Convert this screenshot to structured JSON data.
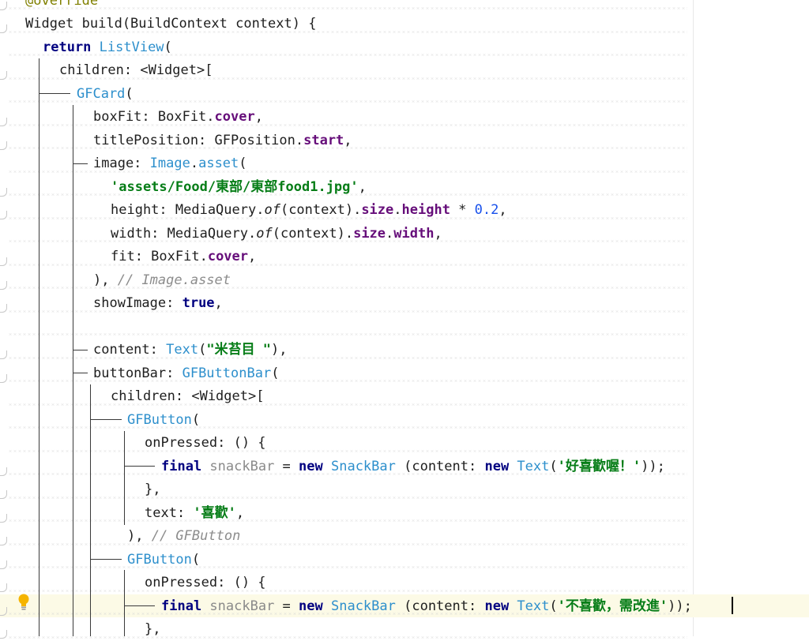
{
  "editor": {
    "lines": [
      {
        "id": "l0",
        "tokens": [
          [
            "anno",
            "@override"
          ]
        ]
      },
      {
        "id": "l1",
        "tokens": [
          [
            "",
            "Widget build(BuildContext context) {"
          ]
        ]
      },
      {
        "id": "l2",
        "tokens": [
          [
            "kw",
            "return "
          ],
          [
            "cls",
            "ListView"
          ],
          [
            "",
            "("
          ]
        ]
      },
      {
        "id": "l3",
        "tokens": [
          [
            "",
            "children: <Widget>["
          ]
        ]
      },
      {
        "id": "l4",
        "tokens": [
          [
            "cls",
            "GFCard"
          ],
          [
            "",
            "("
          ]
        ]
      },
      {
        "id": "l5",
        "tokens": [
          [
            "",
            "boxFit: BoxFit."
          ],
          [
            "fld",
            "cover"
          ],
          [
            "",
            ","
          ]
        ]
      },
      {
        "id": "l6",
        "tokens": [
          [
            "",
            "titlePosition: GFPosition."
          ],
          [
            "fld",
            "start"
          ],
          [
            "",
            ","
          ]
        ]
      },
      {
        "id": "l7",
        "tokens": [
          [
            "",
            "image: "
          ],
          [
            "cls",
            "Image"
          ],
          [
            "",
            "."
          ],
          [
            "cls",
            "asset"
          ],
          [
            "",
            "("
          ]
        ]
      },
      {
        "id": "l8",
        "tokens": [
          [
            "str",
            "'assets/Food/東部/東部food1.jpg'"
          ],
          [
            "",
            ","
          ]
        ]
      },
      {
        "id": "l9",
        "tokens": [
          [
            "",
            "height: MediaQuery."
          ],
          [
            "ital",
            "of"
          ],
          [
            "",
            "(context)."
          ],
          [
            "fld",
            "size"
          ],
          [
            "",
            "."
          ],
          [
            "fld",
            "height"
          ],
          [
            "",
            " * "
          ],
          [
            "num",
            "0.2"
          ],
          [
            "",
            ","
          ]
        ]
      },
      {
        "id": "l10",
        "tokens": [
          [
            "",
            "width: MediaQuery."
          ],
          [
            "ital",
            "of"
          ],
          [
            "",
            "(context)."
          ],
          [
            "fld",
            "size"
          ],
          [
            "",
            "."
          ],
          [
            "fld",
            "width"
          ],
          [
            "",
            ","
          ]
        ]
      },
      {
        "id": "l11",
        "tokens": [
          [
            "",
            "fit: BoxFit."
          ],
          [
            "fld",
            "cover"
          ],
          [
            "",
            ","
          ]
        ]
      },
      {
        "id": "l12",
        "tokens": [
          [
            "",
            "), "
          ],
          [
            "cmt",
            "// Image.asset"
          ]
        ]
      },
      {
        "id": "l13",
        "tokens": [
          [
            "",
            "showImage: "
          ],
          [
            "kw",
            "true"
          ],
          [
            "",
            ","
          ]
        ]
      },
      {
        "id": "l14",
        "tokens": []
      },
      {
        "id": "l15",
        "tokens": [
          [
            "",
            "content: "
          ],
          [
            "cls",
            "Text"
          ],
          [
            "",
            "("
          ],
          [
            "str",
            "\"米苔目 \""
          ],
          [
            "",
            "),"
          ]
        ]
      },
      {
        "id": "l16",
        "tokens": [
          [
            "",
            "buttonBar: "
          ],
          [
            "cls",
            "GFButtonBar"
          ],
          [
            "",
            "("
          ]
        ]
      },
      {
        "id": "l17",
        "tokens": [
          [
            "",
            "children: <Widget>["
          ]
        ]
      },
      {
        "id": "l18",
        "tokens": [
          [
            "cls",
            "GFButton"
          ],
          [
            "",
            "("
          ]
        ]
      },
      {
        "id": "l19",
        "tokens": [
          [
            "",
            "onPressed: () {"
          ]
        ]
      },
      {
        "id": "l20",
        "tokens": [
          [
            "kw",
            "final "
          ],
          [
            "unused",
            "snackBar"
          ],
          [
            "",
            " = "
          ],
          [
            "kw",
            "new "
          ],
          [
            "cls",
            "SnackBar"
          ],
          [
            "",
            " (content: "
          ],
          [
            "kw",
            "new "
          ],
          [
            "cls",
            "Text"
          ],
          [
            "",
            "("
          ],
          [
            "str",
            "'好喜歡喔！'"
          ],
          [
            "",
            "));"
          ]
        ]
      },
      {
        "id": "l21",
        "tokens": [
          [
            "",
            "},"
          ]
        ]
      },
      {
        "id": "l22",
        "tokens": [
          [
            "",
            "text: "
          ],
          [
            "str",
            "'喜歡'"
          ],
          [
            "",
            ","
          ]
        ]
      },
      {
        "id": "l23",
        "tokens": [
          [
            "",
            "), "
          ],
          [
            "cmt",
            "// GFButton"
          ]
        ]
      },
      {
        "id": "l24",
        "tokens": [
          [
            "cls",
            "GFButton"
          ],
          [
            "",
            "("
          ]
        ]
      },
      {
        "id": "l25",
        "tokens": [
          [
            "",
            "onPressed: () {"
          ]
        ]
      },
      {
        "id": "l26",
        "tokens": [
          [
            "kw",
            "final "
          ],
          [
            "unused",
            "snackBar"
          ],
          [
            "",
            " = "
          ],
          [
            "kw",
            "new "
          ],
          [
            "cls",
            "SnackBar"
          ],
          [
            "",
            " (content: "
          ],
          [
            "kw",
            "new "
          ],
          [
            "cls",
            "Text"
          ],
          [
            "",
            "("
          ],
          [
            "str",
            "'不喜歡，需改進'"
          ],
          [
            "",
            "));"
          ]
        ]
      },
      {
        "id": "l27",
        "tokens": [
          [
            "",
            "},"
          ]
        ]
      }
    ],
    "current_line": "l26",
    "intention_icon": "lightbulb-icon"
  }
}
